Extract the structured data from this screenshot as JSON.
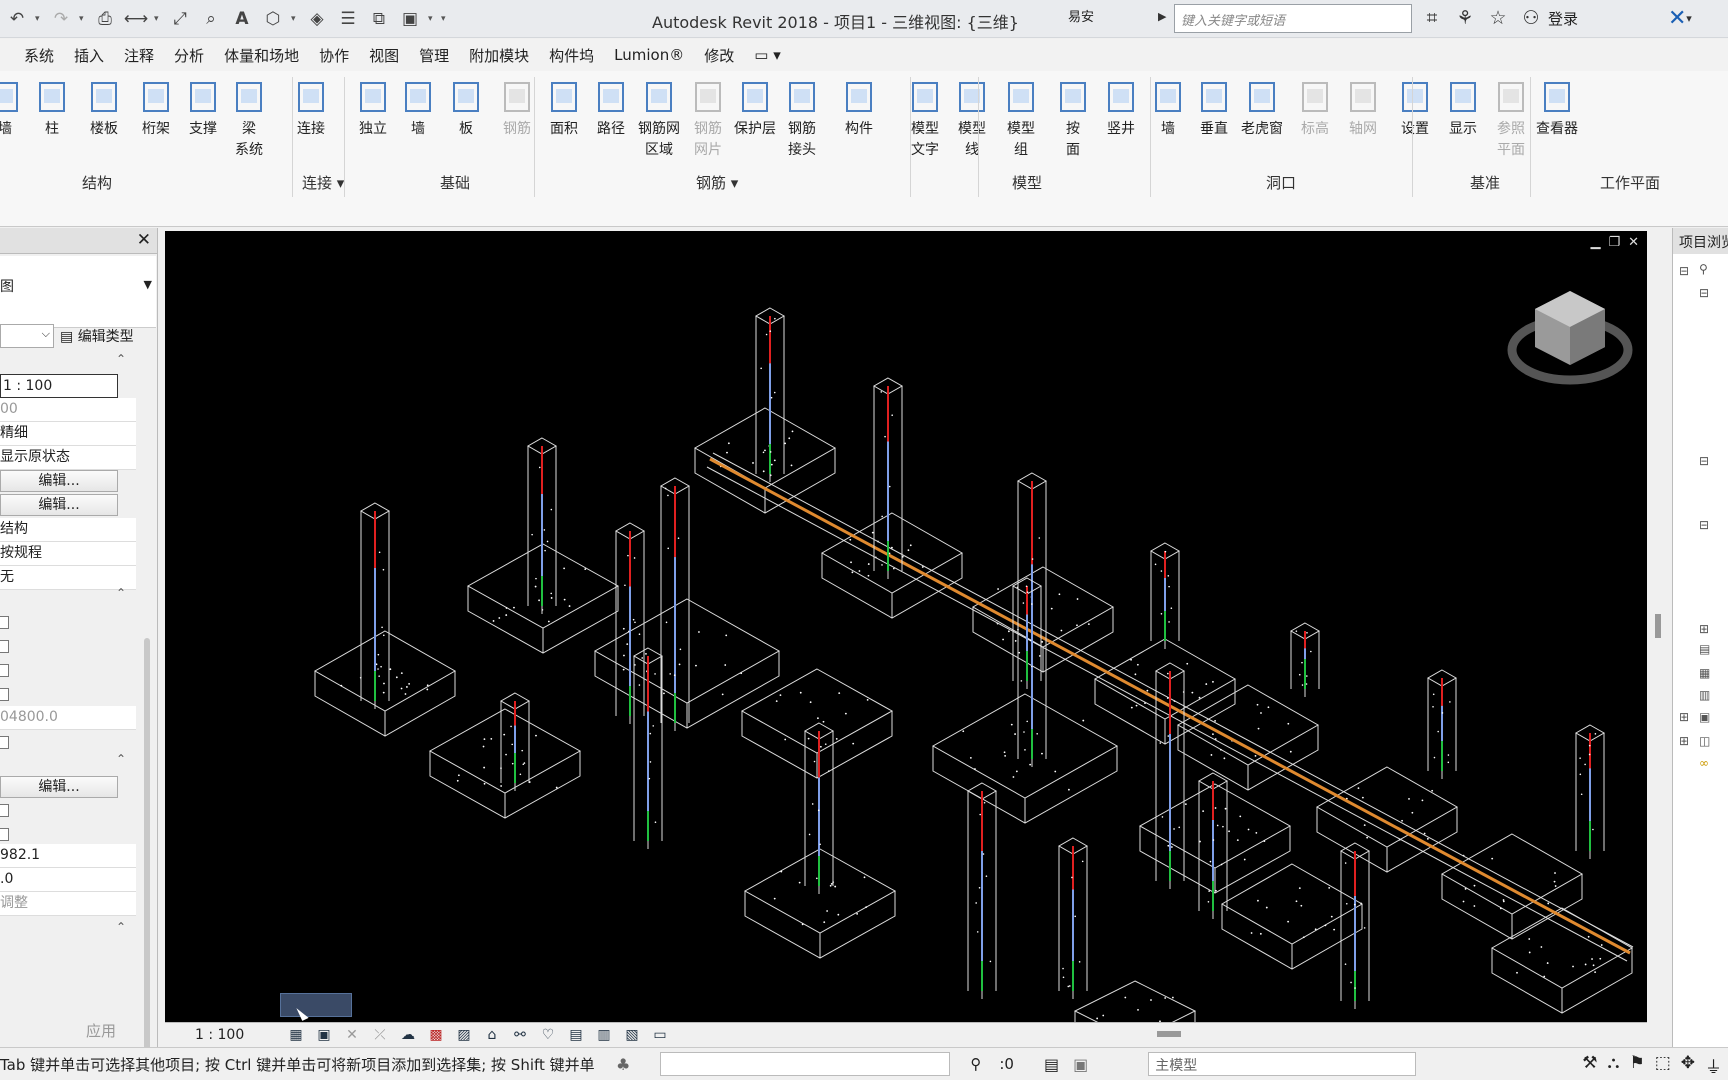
{
  "app": {
    "title": "Autodesk Revit 2018 -    项目1 - 三维视图: {三维}",
    "user_label": "易安",
    "search_placeholder": "键入关键字或短语",
    "login": "登录"
  },
  "menu": [
    "系统",
    "插入",
    "注释",
    "分析",
    "体量和场地",
    "协作",
    "视图",
    "管理",
    "附加模块",
    "构件坞",
    "Lumion®",
    "修改"
  ],
  "ribbon": {
    "buttons": [
      {
        "label": "墙",
        "disabled": false
      },
      {
        "label": "柱",
        "disabled": false
      },
      {
        "label": "楼板",
        "disabled": false
      },
      {
        "label": "桁架",
        "disabled": false
      },
      {
        "label": "支撑",
        "disabled": false
      },
      {
        "label": "梁\n系统",
        "disabled": false
      },
      {
        "label": "连接",
        "disabled": false
      },
      {
        "label": "独立",
        "disabled": false
      },
      {
        "label": "墙",
        "disabled": false
      },
      {
        "label": "板",
        "disabled": false
      },
      {
        "label": "钢筋",
        "disabled": true
      },
      {
        "label": "面积",
        "disabled": false
      },
      {
        "label": "路径",
        "disabled": false
      },
      {
        "label": "钢筋网\n区域",
        "disabled": false
      },
      {
        "label": "钢筋\n网片",
        "disabled": true
      },
      {
        "label": "保护层",
        "disabled": false
      },
      {
        "label": "钢筋\n接头",
        "disabled": false
      },
      {
        "label": "构件",
        "disabled": false
      },
      {
        "label": "模型\n文字",
        "disabled": false
      },
      {
        "label": "模型\n线",
        "disabled": false
      },
      {
        "label": "模型\n组",
        "disabled": false
      },
      {
        "label": "按\n面",
        "disabled": false
      },
      {
        "label": "竖井",
        "disabled": false
      },
      {
        "label": "墙",
        "disabled": false
      },
      {
        "label": "垂直",
        "disabled": false
      },
      {
        "label": "老虎窗",
        "disabled": false
      },
      {
        "label": "标高",
        "disabled": true
      },
      {
        "label": "轴网",
        "disabled": true
      },
      {
        "label": "设置",
        "disabled": false
      },
      {
        "label": "显示",
        "disabled": false
      },
      {
        "label": "参照\n平面",
        "disabled": true
      },
      {
        "label": "查看器",
        "disabled": false
      }
    ],
    "groups": [
      "结构",
      "连接 ▾",
      "基础",
      "钢筋 ▾",
      "模型",
      "洞口",
      "基准",
      "工作平面"
    ]
  },
  "properties": {
    "type_label": "图",
    "edit_type": "编辑类型",
    "rows": [
      "1 : 100",
      "00",
      "精细",
      "显示原状态",
      "编辑...",
      "编辑...",
      "结构",
      "按规程",
      "无"
    ],
    "rows2": [
      "04800.0"
    ],
    "rows3": [
      "编辑...",
      "982.1",
      ".0",
      "调整"
    ],
    "apply": "应用"
  },
  "browser": {
    "title": "项目浏览器"
  },
  "viewbar": {
    "scale": "1 : 100"
  },
  "status": {
    "text": "Tab 键并单击可选择其他项目; 按 Ctrl 键并单击可将新项目添加到选择集; 按 Shift 键并单",
    "zero": ":0",
    "model": "主模型"
  },
  "colors": {
    "viewport_bg": "#000000",
    "beam": "#e08a2f",
    "rebar_red": "#e02020",
    "rebar_blue": "#7f9fe8",
    "rebar_green": "#20c040"
  }
}
